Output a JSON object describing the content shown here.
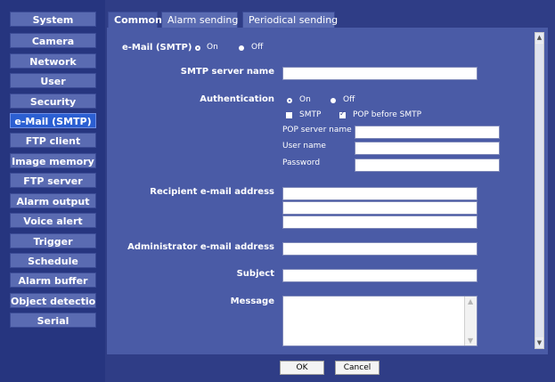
{
  "sidebar": {
    "items": [
      {
        "label": "System"
      },
      {
        "label": "Camera"
      },
      {
        "label": "Network"
      },
      {
        "label": "User"
      },
      {
        "label": "Security"
      },
      {
        "label": "e-Mail (SMTP)"
      },
      {
        "label": "FTP client"
      },
      {
        "label": "Image memory"
      },
      {
        "label": "FTP server"
      },
      {
        "label": "Alarm output"
      },
      {
        "label": "Voice alert"
      },
      {
        "label": "Trigger"
      },
      {
        "label": "Schedule"
      },
      {
        "label": "Alarm buffer"
      },
      {
        "label": "Object detection"
      },
      {
        "label": "Serial"
      }
    ],
    "active": "e-Mail (SMTP)"
  },
  "tabs": [
    {
      "label": "Common"
    },
    {
      "label": "Alarm sending"
    },
    {
      "label": "Periodical sending"
    }
  ],
  "form": {
    "email_label": "e-Mail (SMTP)",
    "on_label": "On",
    "off_label": "Off",
    "smtp_server_label": "SMTP server name",
    "authentication_label": "Authentication",
    "auth_on_label": "On",
    "auth_off_label": "Off",
    "smtp_check_label": "SMTP",
    "pop_check_label": "POP before SMTP",
    "pop_server_label": "POP server name",
    "user_name_label": "User name",
    "password_label": "Password",
    "recipient_label": "Recipient e-mail address",
    "admin_label": "Administrator e-mail address",
    "subject_label": "Subject",
    "message_label": "Message"
  },
  "buttons": {
    "ok": "OK",
    "cancel": "Cancel"
  },
  "colors": {
    "background": "#2f3d86",
    "panel": "#4a5ba6",
    "sidebar_item": "#5a6bb2",
    "sidebar_active": "#2b5fd2"
  }
}
